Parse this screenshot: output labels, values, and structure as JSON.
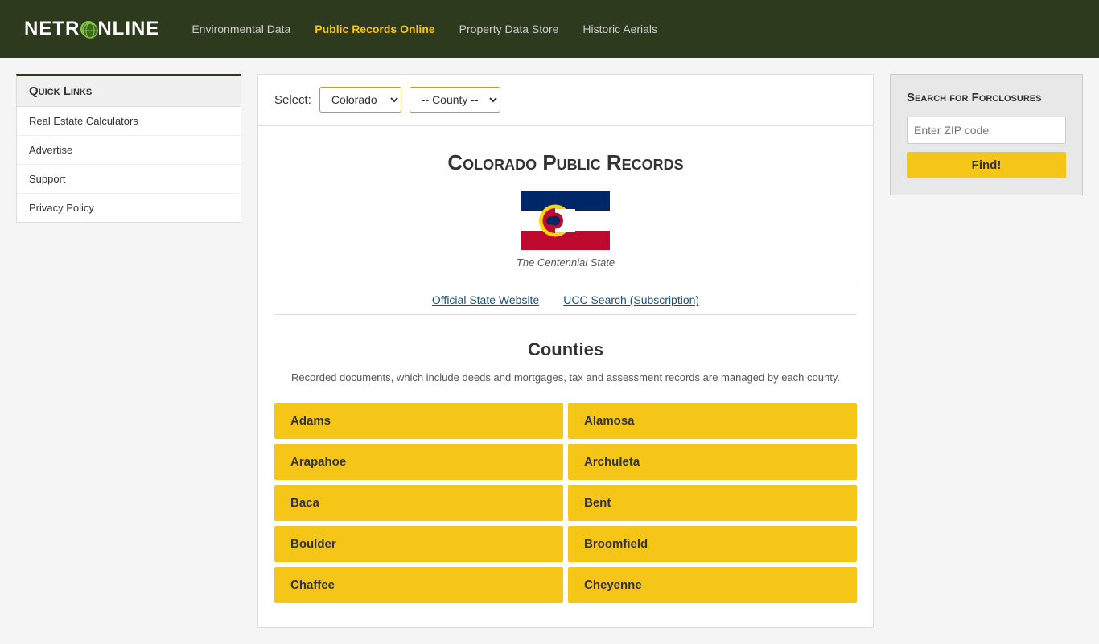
{
  "header": {
    "logo": "NETRONLINE",
    "nav": [
      {
        "label": "Environmental Data",
        "active": false,
        "name": "nav-environmental"
      },
      {
        "label": "Public Records Online",
        "active": true,
        "name": "nav-public-records"
      },
      {
        "label": "Property Data Store",
        "active": false,
        "name": "nav-property-data"
      },
      {
        "label": "Historic Aerials",
        "active": false,
        "name": "nav-historic-aerials"
      }
    ]
  },
  "select_bar": {
    "label": "Select:",
    "state_default": "Colorado",
    "county_default": "-- County --"
  },
  "main": {
    "title": "Colorado Public Records",
    "state_nickname": "The Centennial State",
    "links": [
      {
        "label": "Official State Website",
        "name": "official-state-link"
      },
      {
        "label": "UCC Search (Subscription)",
        "name": "ucc-search-link"
      }
    ],
    "counties_title": "Counties",
    "counties_description": "Recorded documents, which include deeds and mortgages, tax and assessment records are managed by each county.",
    "counties": [
      "Adams",
      "Alamosa",
      "Arapahoe",
      "Archuleta",
      "Baca",
      "Bent",
      "Boulder",
      "Broomfield",
      "Chaffee",
      "Cheyenne"
    ]
  },
  "sidebar": {
    "title": "Quick Links",
    "items": [
      {
        "label": "Real Estate Calculators",
        "name": "sidebar-calculators"
      },
      {
        "label": "Advertise",
        "name": "sidebar-advertise"
      },
      {
        "label": "Support",
        "name": "sidebar-support"
      },
      {
        "label": "Privacy Policy",
        "name": "sidebar-privacy"
      }
    ]
  },
  "foreclosure": {
    "title": "Search for Forclosures",
    "zip_placeholder": "Enter ZIP code",
    "find_label": "Find!"
  }
}
